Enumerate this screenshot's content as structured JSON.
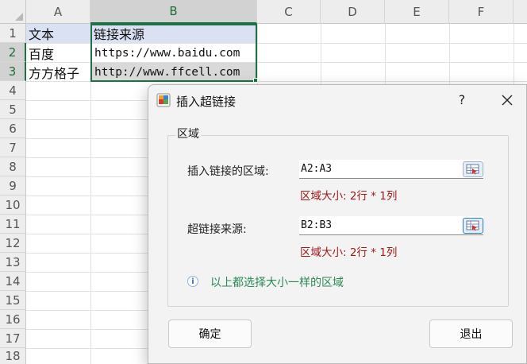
{
  "spreadsheet": {
    "columns": [
      "A",
      "B",
      "C",
      "D",
      "E",
      "F"
    ],
    "rows": [
      "1",
      "2",
      "3",
      "4",
      "5",
      "6",
      "7",
      "8",
      "9",
      "10",
      "11",
      "12",
      "13",
      "14",
      "15",
      "16",
      "17",
      "18"
    ],
    "cells": {
      "A1": "文本",
      "B1": "链接来源",
      "A2": "百度",
      "B2": "https://www.baidu.com",
      "A3": "方方格子",
      "B3": "http://www.ffcell.com"
    }
  },
  "dialog": {
    "title": "插入超链接",
    "help_label": "?",
    "group_label": "区域",
    "insert_range_label": "插入链接的区域:",
    "insert_range_value": "A2:A3",
    "insert_range_size": "区域大小:  2行 * 1列",
    "source_label": "超链接来源:",
    "source_value": "B2:B3",
    "source_size": "区域大小:  2行 * 1列",
    "hint_text": "以上都选择大小一样的区域",
    "ok_label": "确定",
    "exit_label": "退出",
    "colors": {
      "accent_green": "#1e7145",
      "size_text": "#a01818",
      "hint_text": "#2b8a56"
    }
  }
}
